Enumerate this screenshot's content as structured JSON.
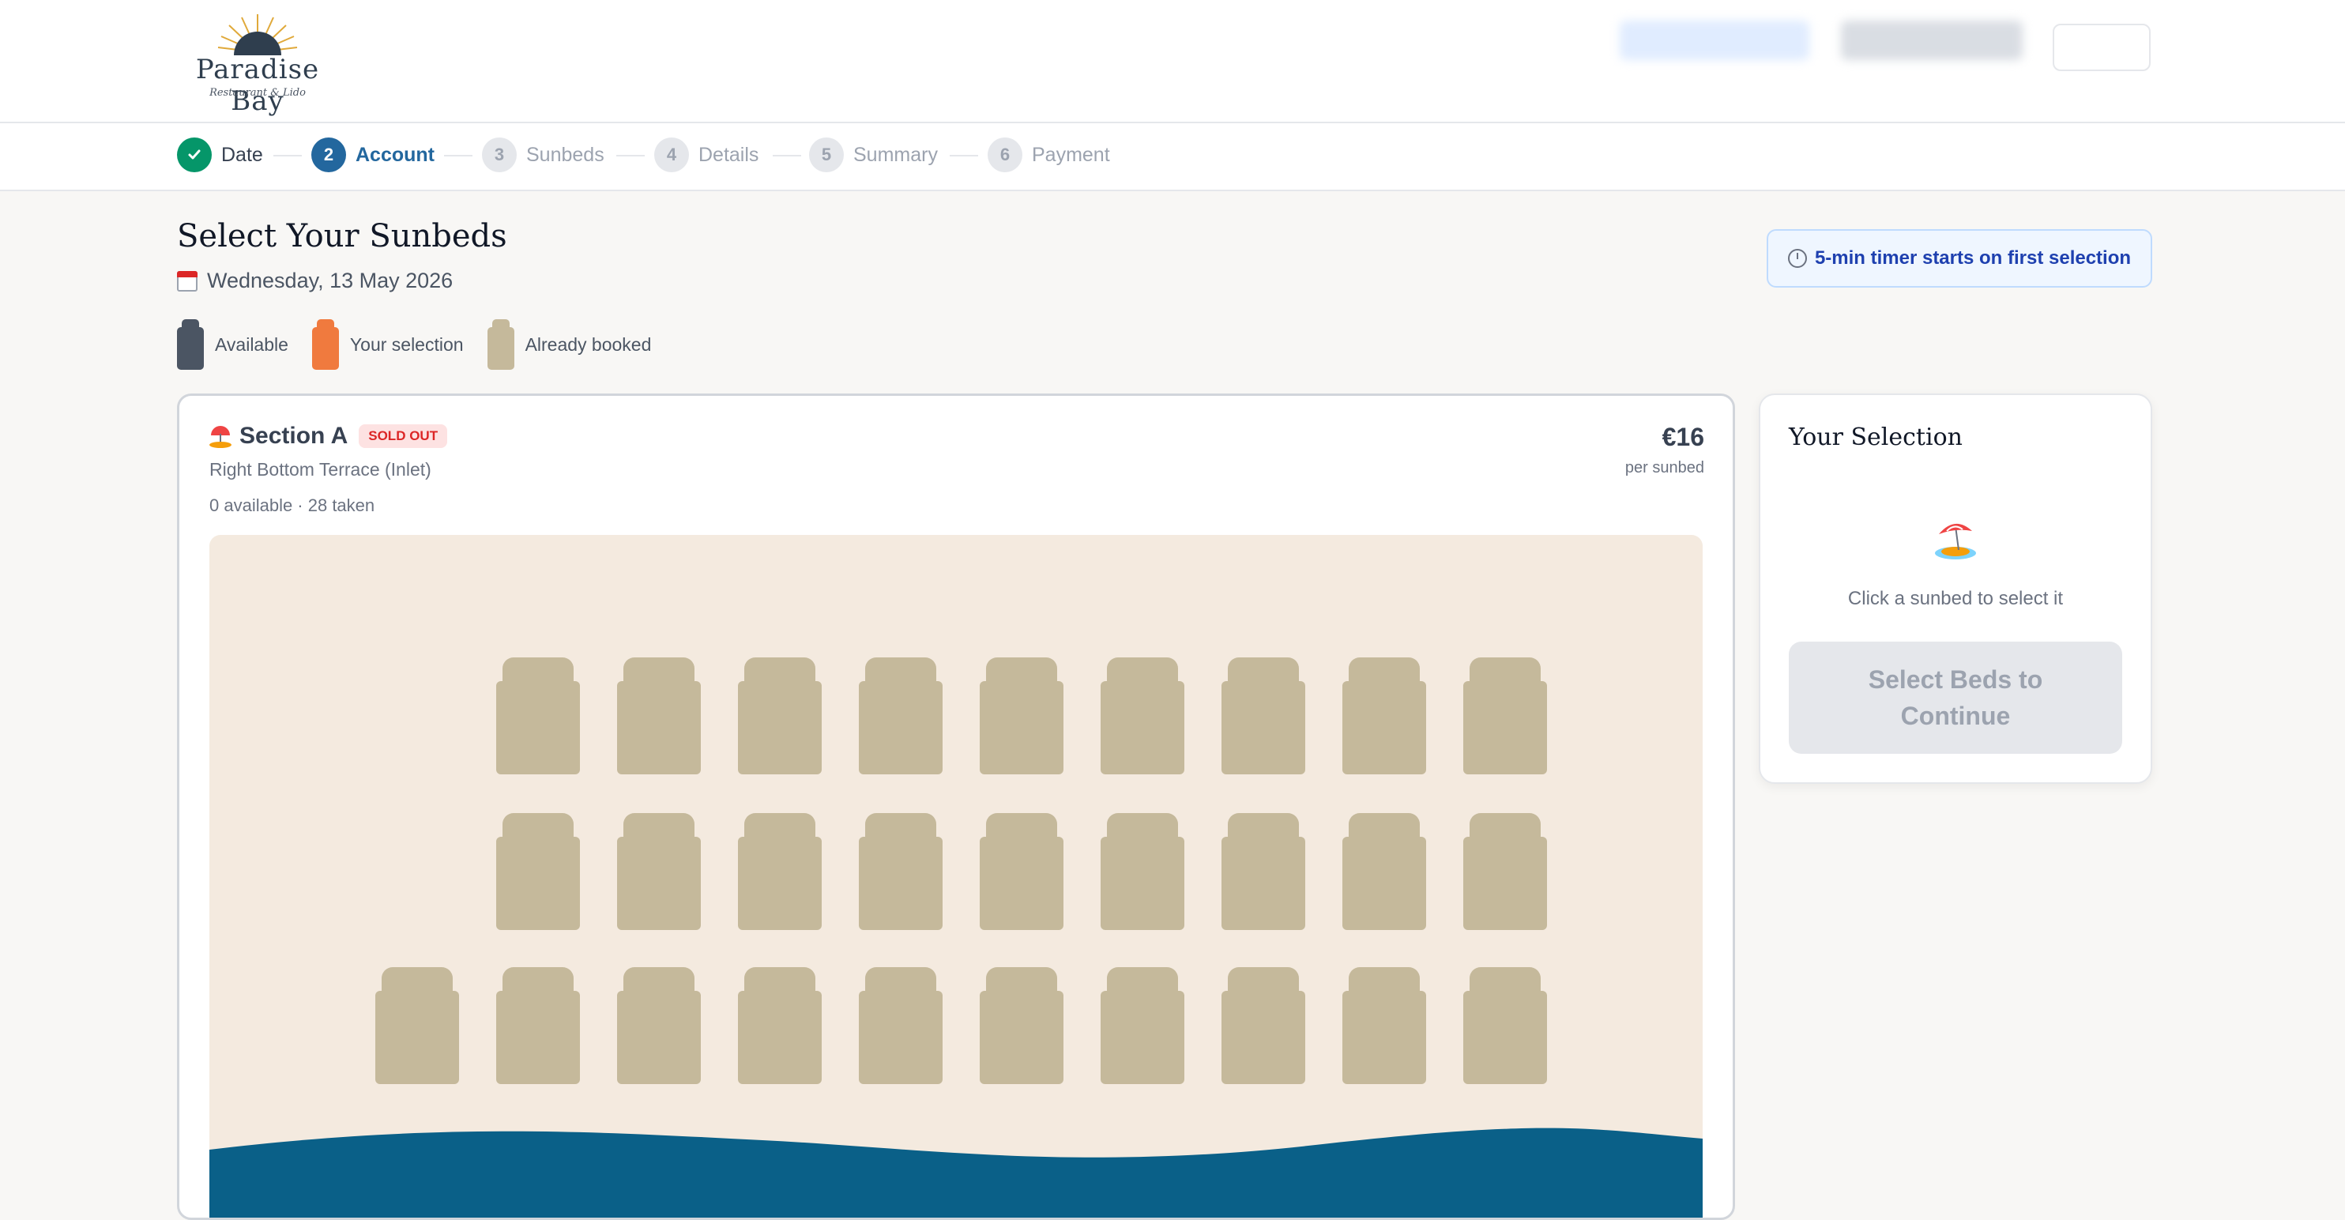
{
  "brand": {
    "name": "Paradise Bay",
    "tagline": "Restaurant & Lido"
  },
  "stepper": [
    {
      "number": "",
      "label": "Date",
      "state": "done"
    },
    {
      "number": "2",
      "label": "Account",
      "state": "active"
    },
    {
      "number": "3",
      "label": "Sunbeds",
      "state": "todo"
    },
    {
      "number": "4",
      "label": "Details",
      "state": "todo"
    },
    {
      "number": "5",
      "label": "Summary",
      "state": "todo"
    },
    {
      "number": "6",
      "label": "Payment",
      "state": "todo"
    }
  ],
  "page": {
    "title": "Select Your Sunbeds",
    "date": "Wednesday, 13 May 2026",
    "timer_notice": "5-min timer starts on first selection"
  },
  "legend": [
    {
      "label": "Available",
      "color": "#4b5563"
    },
    {
      "label": "Your selection",
      "color": "#f07a3e"
    },
    {
      "label": "Already booked",
      "color": "#c5b99b"
    }
  ],
  "section": {
    "name": "Section A",
    "badge": "SOLD OUT",
    "subtitle": "Right Bottom Terrace (Inlet)",
    "availability": "0 available · 28 taken",
    "price": "€16",
    "price_unit": "per sunbed",
    "rows": [
      {
        "beds": 9,
        "status": "booked"
      },
      {
        "beds": 9,
        "status": "booked"
      },
      {
        "beds": 10,
        "status": "booked"
      }
    ]
  },
  "selection_panel": {
    "title": "Your Selection",
    "hint": "Click a sunbed to select it",
    "button": "Select Beds to Continue"
  },
  "colors": {
    "booked": "#c5b99b",
    "sand": "#f4eadf",
    "sea": "#0a6088",
    "accent": "#23679e",
    "success": "#059669"
  }
}
